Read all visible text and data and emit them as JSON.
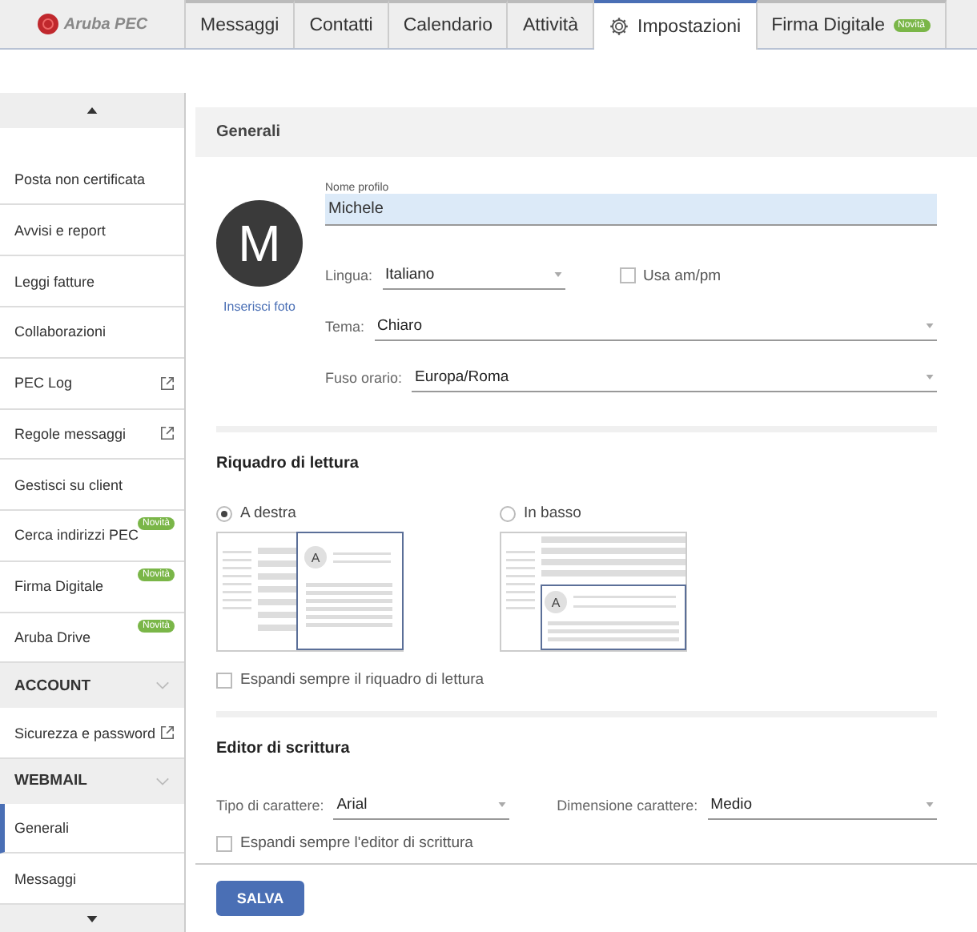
{
  "logo": {
    "text": "Aruba PEC"
  },
  "tabs": [
    {
      "label": "Messaggi",
      "selected": false
    },
    {
      "label": "Contatti",
      "selected": false
    },
    {
      "label": "Calendario",
      "selected": false
    },
    {
      "label": "Attività",
      "selected": false
    },
    {
      "label": "Impostazioni",
      "selected": true,
      "icon": true
    },
    {
      "label": "Firma Digitale",
      "selected": false,
      "badge": "Novità"
    }
  ],
  "sidebar": {
    "items": [
      {
        "kind": "item",
        "label": "Posta non certificata",
        "selected": false
      },
      {
        "kind": "item",
        "label": "Avvisi e report",
        "selected": false
      },
      {
        "kind": "item",
        "label": "Leggi fatture",
        "selected": false
      },
      {
        "kind": "item",
        "label": "Collaborazioni",
        "selected": false
      },
      {
        "kind": "item",
        "label": "PEC Log",
        "selected": false,
        "external": true
      },
      {
        "kind": "item",
        "label": "Regole messaggi",
        "selected": false,
        "external": true
      },
      {
        "kind": "item",
        "label": "Gestisci su client",
        "selected": false
      },
      {
        "kind": "item",
        "label": "Cerca indirizzi PEC",
        "selected": false,
        "badge": "Novità"
      },
      {
        "kind": "item",
        "label": "Firma Digitale",
        "selected": false,
        "badge": "Novità"
      },
      {
        "kind": "item",
        "label": "Aruba Drive",
        "selected": false,
        "badge": "Novità"
      },
      {
        "kind": "header",
        "label": "ACCOUNT",
        "expanded": true
      },
      {
        "kind": "item",
        "label": "Sicurezza e password",
        "selected": false,
        "external": true
      },
      {
        "kind": "header",
        "label": "WEBMAIL",
        "expanded": true
      },
      {
        "kind": "item",
        "label": "Generali",
        "selected": true
      },
      {
        "kind": "item",
        "label": "Messaggi",
        "selected": false
      }
    ]
  },
  "panel": {
    "title": "Generali",
    "profile": {
      "avatar_letter": "M",
      "photo_link": "Inserisci foto",
      "name_label": "Nome profilo",
      "name_value": "Michele",
      "language": {
        "label": "Lingua:",
        "value": "Italiano"
      },
      "ampm": {
        "label": "Usa am/pm",
        "checked": false
      },
      "theme": {
        "label": "Tema:",
        "value": "Chiaro"
      },
      "timezone": {
        "label": "Fuso orario:",
        "value": "Europa/Roma"
      }
    },
    "reading_pane": {
      "title": "Riquadro di lettura",
      "options": [
        {
          "label": "A destra",
          "kind": "right",
          "selected": true,
          "avatar": "A"
        },
        {
          "label": "In basso",
          "kind": "bottom",
          "selected": false,
          "avatar": "A"
        }
      ],
      "expand": {
        "label": "Espandi sempre il riquadro di lettura",
        "checked": false
      }
    },
    "editor": {
      "title": "Editor di scrittura",
      "font": {
        "label": "Tipo di carattere:",
        "value": "Arial"
      },
      "size": {
        "label": "Dimensione carattere:",
        "value": "Medio"
      },
      "expand": {
        "label": "Espandi sempre l'editor di scrittura",
        "checked": false
      }
    },
    "save_button": "SALVA"
  }
}
